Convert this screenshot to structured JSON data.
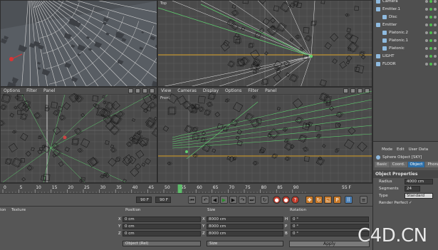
{
  "viewports": {
    "perspective": {
      "label": ""
    },
    "top": {
      "label": "Top"
    },
    "right": {
      "menu": [
        "Options",
        "Filter",
        "Panel"
      ]
    },
    "front": {
      "menu": [
        "View",
        "Cameras",
        "Display",
        "Options",
        "Filter",
        "Panel"
      ],
      "label": "Front"
    }
  },
  "object_manager": {
    "items": [
      {
        "name": "Camera",
        "indent": 0
      },
      {
        "name": "Emitter.1",
        "indent": 0
      },
      {
        "name": "Disc",
        "indent": 1
      },
      {
        "name": "Emitter",
        "indent": 0
      },
      {
        "name": "Platonic.2",
        "indent": 1
      },
      {
        "name": "Platonic.1",
        "indent": 1
      },
      {
        "name": "Platonic",
        "indent": 1
      },
      {
        "name": "LIGHT",
        "indent": 0
      },
      {
        "name": "FLOOR",
        "indent": 0
      }
    ]
  },
  "attribute_manager": {
    "menu": [
      "Mode",
      "Edit",
      "User Data"
    ],
    "object_title": "Sphere Object [SKY]",
    "tabs": [
      "Basic",
      "Coord.",
      "Object",
      "Phong"
    ],
    "active_tab": "Object",
    "section": "Object Properties",
    "fields": [
      {
        "label": "Radius",
        "value": "4000 cm"
      },
      {
        "label": "Segments",
        "value": "24"
      },
      {
        "label": "Type",
        "value": "Standard"
      },
      {
        "label": "Render Perfect",
        "value": "✓"
      }
    ]
  },
  "timeline": {
    "ticks": [
      "0",
      "5",
      "10",
      "15",
      "20",
      "25",
      "30",
      "35",
      "40",
      "45",
      "50",
      "55",
      "60",
      "65",
      "70",
      "75",
      "80",
      "85",
      "90"
    ],
    "current_frame": "55",
    "end_label": "55 F"
  },
  "transport": {
    "start_field": "90 F",
    "end_field": "90 F"
  },
  "coordinates": {
    "left_tabs": [
      "ion",
      "Texture"
    ],
    "headers": {
      "position": "Position",
      "size": "Size",
      "rotation": "Rotation"
    },
    "rows": [
      {
        "axis": "X",
        "position": "0 cm",
        "size": "8000 cm",
        "rot_axis": "H",
        "rotation": "0 °"
      },
      {
        "axis": "Y",
        "position": "0 cm",
        "size": "8000 cm",
        "rot_axis": "P",
        "rotation": "0 °"
      },
      {
        "axis": "Z",
        "position": "0 cm",
        "size": "8000 cm",
        "rot_axis": "B",
        "rotation": "0 °"
      }
    ],
    "mode_dropdown": "Object (Rel)",
    "size_dropdown": "Size",
    "apply_label": "Apply"
  },
  "watermark": "C4D.CN",
  "colors": {
    "selection_blue": "#2d6fa8",
    "axis_orange": "#d9a227",
    "spline_green": "#5fcf6f"
  }
}
